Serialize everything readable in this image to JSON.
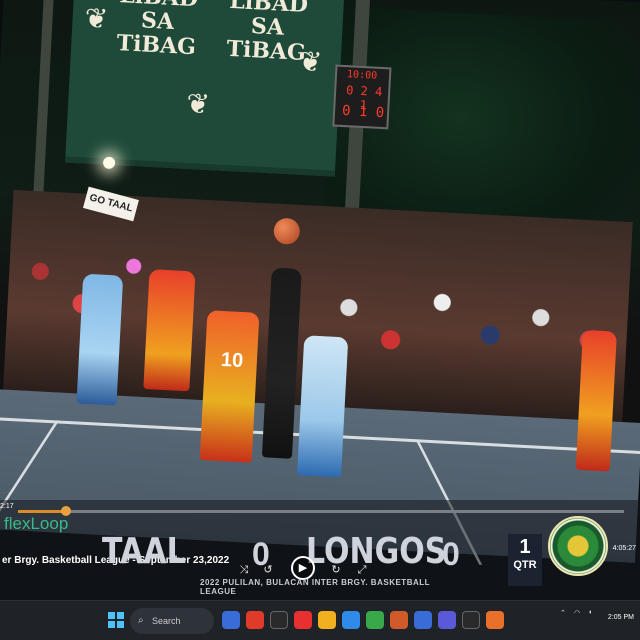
{
  "video": {
    "banner_left": "LiBAD SA TiBAG",
    "banner_right": "LiBAD SA TiBAG",
    "scoreboard": {
      "time": "10:00",
      "middle": "0 2 4 1",
      "bottom": "0 1 0"
    },
    "sign": "GO TAAL",
    "jersey_number": "10"
  },
  "player_bar": {
    "brand": "flexLoop",
    "time_elapsed": "2:17",
    "time_total": "4:05:27",
    "progress_fraction": 0.08,
    "title": "er Brgy. Basketball League - September 23,2022",
    "home_team": "TAAL",
    "home_score": "0",
    "away_team": "LONGOS",
    "away_score": "0",
    "period_number": "1",
    "period_label": "QTR",
    "league_strip": "2022 PULILAN, BULACAN INTER BRGY. BASKETBALL LEAGUE",
    "controls": [
      "shuffle-icon",
      "replay-icon",
      "play-icon",
      "forward-icon",
      "fullscreen-icon"
    ]
  },
  "taskbar": {
    "search_label": "Search",
    "clock": "2:05 PM",
    "accent": "#4cc2ff"
  }
}
